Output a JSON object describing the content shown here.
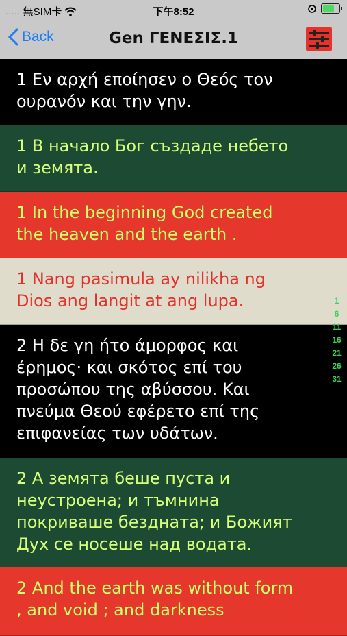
{
  "status_bar": {
    "signal": ".....",
    "carrier": "無SIM卡",
    "time": "下午8:52"
  },
  "nav": {
    "back_label": "Back",
    "title": "Gen ΓΕΝΕΣΙΣ.1"
  },
  "verses": [
    {
      "lang": "greek",
      "text": "1 Εν αρχή εποίησεν ο Θεός τον ουρανόν και την γην."
    },
    {
      "lang": "bulgarian",
      "text": "1 В начало Бог създаде небето и земята."
    },
    {
      "lang": "english",
      "text": "1 In the beginning God created the heaven and the earth ."
    },
    {
      "lang": "tagalog",
      "text": "1 Nang pasimula ay nilikha ng Dios ang langit at ang lupa."
    },
    {
      "lang": "greek",
      "text": "2 Η δε γη ήτο άμορφος και έρημος· και σκότος επί του προσώπου της αβύσσου. Και πνεύμα Θεού εφέρετο επί της επιφανείας των υδάτων."
    },
    {
      "lang": "bulgarian",
      "text": "2 А земята беше пуста и неустроена; и тъмнина покриваше бездната; и Божият Дух се носеше над водата."
    },
    {
      "lang": "english",
      "text": "2 And the earth was without form , and void ; and darkness"
    }
  ],
  "verse_index": [
    "1",
    "6",
    "11",
    "16",
    "21",
    "26",
    "31"
  ],
  "colors": {
    "greek_bg": "#000000",
    "bulgarian_bg": "#1d4a33",
    "english_bg": "#e5372b",
    "tagalog_bg": "#e0dccb",
    "accent": "#1e7cf5"
  }
}
